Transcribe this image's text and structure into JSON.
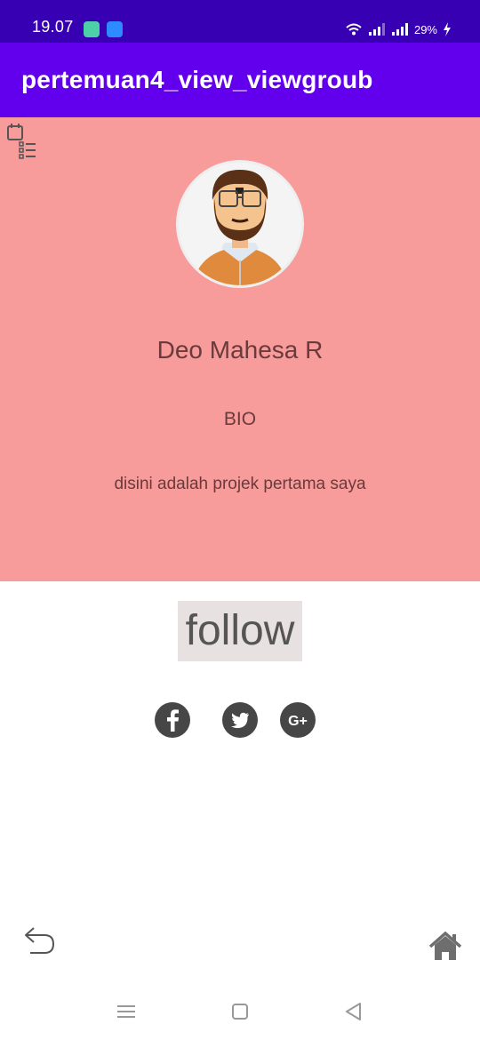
{
  "status_bar": {
    "time": "19.07",
    "battery": "29%",
    "icons": [
      "shield-app-icon",
      "usb-icon",
      "wifi-icon",
      "signal-icon",
      "signal-icon",
      "battery-charging-icon"
    ]
  },
  "app_bar": {
    "title": "pertemuan4_view_viewgroub"
  },
  "profile": {
    "name": "Deo Mahesa R",
    "bio_label": "BIO",
    "bio": "disini adalah projek pertama saya"
  },
  "follow": {
    "label": "follow"
  },
  "social": {
    "icons": [
      "facebook-icon",
      "twitter-icon",
      "google-plus-icon"
    ],
    "google_plus_text": "G+"
  },
  "bottom_actions": {
    "icons": [
      "back-arrow-icon",
      "home-icon"
    ]
  },
  "nav_bar": {
    "icons": [
      "recent-apps-icon",
      "home-nav-icon",
      "back-nav-icon"
    ]
  },
  "colors": {
    "status_bar": "#3700b3",
    "app_bar": "#6200ee",
    "profile_panel": "#f79b9b",
    "profile_text": "#6b3a3a",
    "follow_bg": "#e7e1e1",
    "social_icon": "#464646"
  }
}
